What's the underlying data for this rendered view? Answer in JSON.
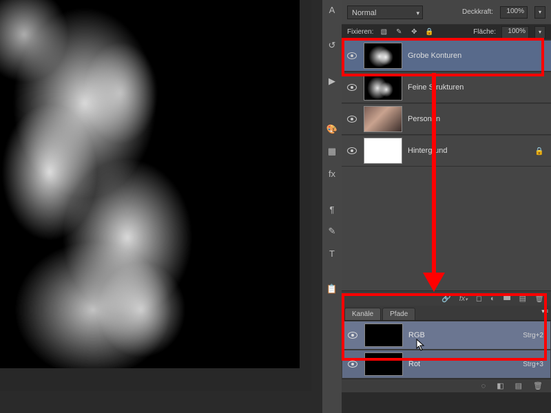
{
  "top": {
    "blend_mode": "Normal",
    "opacity_label": "Deckkraft:",
    "opacity_value": "100%",
    "lock_label": "Fixieren:",
    "fill_label": "Fläche:",
    "fill_value": "100%"
  },
  "layers": [
    {
      "name": "Grobe Konturen",
      "selected": true,
      "thumb": "contour",
      "locked": false
    },
    {
      "name": "Feine Strukturen",
      "selected": false,
      "thumb": "contour",
      "locked": false
    },
    {
      "name": "Personen",
      "selected": false,
      "thumb": "photo",
      "locked": false
    },
    {
      "name": "Hintergrund",
      "selected": false,
      "thumb": "white",
      "locked": true
    }
  ],
  "channels": {
    "tab_channels": "Kanäle",
    "tab_paths": "Pfade",
    "rows": [
      {
        "name": "RGB",
        "shortcut": "Strg+2"
      },
      {
        "name": "Rot",
        "shortcut": "Strg+3"
      }
    ]
  },
  "icons": {
    "eye": "eye",
    "lock": "🔒",
    "trash": "🗑",
    "folder": "📁",
    "link": "🔗",
    "fx": "fx",
    "mask": "◧",
    "adjust": "◐",
    "newlayer": "▤",
    "sel": "◌",
    "newch": "▤"
  }
}
